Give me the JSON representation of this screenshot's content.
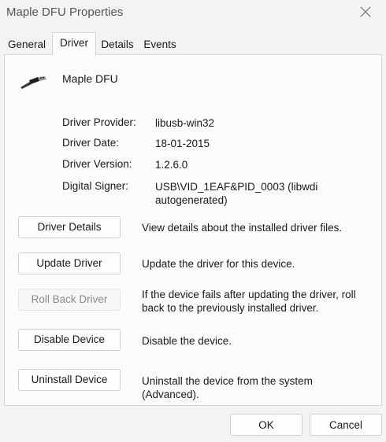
{
  "window": {
    "title": "Maple DFU Properties",
    "close_icon": "close-icon"
  },
  "tabs": [
    {
      "label": "General",
      "active": false
    },
    {
      "label": "Driver",
      "active": true
    },
    {
      "label": "Details",
      "active": false
    },
    {
      "label": "Events",
      "active": false
    }
  ],
  "device": {
    "icon": "usb-plug-icon",
    "name": "Maple DFU"
  },
  "driver_info": [
    {
      "label": "Driver Provider:",
      "value": "libusb-win32"
    },
    {
      "label": "Driver Date:",
      "value": "18-01-2015"
    },
    {
      "label": "Driver Version:",
      "value": "1.2.6.0"
    },
    {
      "label": "Digital Signer:",
      "value": "USB\\VID_1EAF&PID_0003 (libwdi autogenerated)"
    }
  ],
  "actions": [
    {
      "label": "Driver Details",
      "description": "View details about the installed driver files.",
      "enabled": true
    },
    {
      "label": "Update Driver",
      "description": "Update the driver for this device.",
      "enabled": true
    },
    {
      "label": "Roll Back Driver",
      "description": "If the device fails after updating the driver, roll back to the previously installed driver.",
      "enabled": false
    },
    {
      "label": "Disable Device",
      "description": "Disable the device.",
      "enabled": true
    },
    {
      "label": "Uninstall Device",
      "description": "Uninstall the device from the system (Advanced).",
      "enabled": true
    }
  ],
  "footer": {
    "ok_label": "OK",
    "cancel_label": "Cancel"
  }
}
